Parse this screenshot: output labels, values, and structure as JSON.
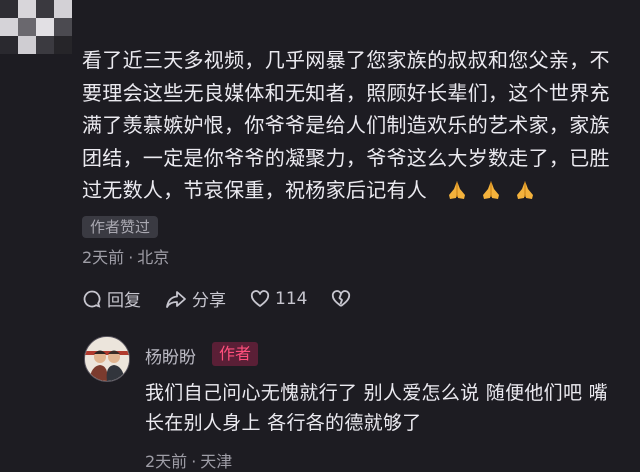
{
  "comment": {
    "text": "看了近三天多视频，几乎网暴了您家族的叔叔和您父亲，不要理会这些无良媒体和无知者，照顾好长辈们，这个世界充满了羡慕嫉妒恨，你爷爷是给人们制造欢乐的艺术家，家族团结，一定是你爷爷的凝聚力，爷爷这么大岁数走了，已胜过无数人，节哀保重，祝杨家后记有人",
    "emoji_icon": "folded-hands-icon",
    "liked_badge": "作者赞过",
    "time": "2天前",
    "separator": "·",
    "location": "北京",
    "actions": {
      "reply_label": "回复",
      "share_label": "分享",
      "like_count": "114"
    }
  },
  "reply": {
    "username": "杨盼盼",
    "author_badge": "作者",
    "text": "我们自己问心无愧就行了 别人爱怎么说 随便他们吧 嘴长在别人身上 各行各的德就够了",
    "time": "2天前",
    "separator": "·",
    "location": "天津"
  },
  "colors": {
    "background": "#1d1c22",
    "author_badge_text": "#ff4f7c",
    "author_badge_bg": "#5a1f36"
  }
}
